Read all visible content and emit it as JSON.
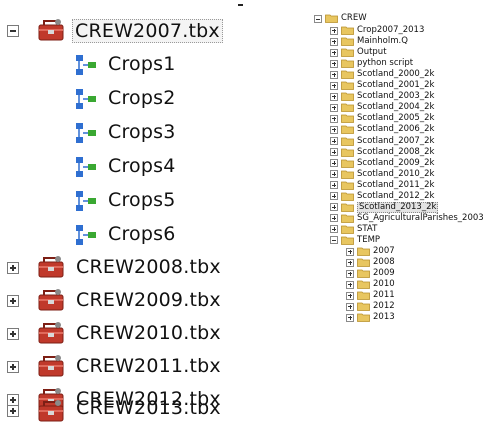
{
  "left_tree": {
    "root": {
      "label": "CREW2007.tbx",
      "expanded": true,
      "icon": "toolbox-icon"
    },
    "models": [
      {
        "label": "Crops1",
        "icon": "model-icon"
      },
      {
        "label": "Crops2",
        "icon": "model-icon"
      },
      {
        "label": "Crops3",
        "icon": "model-icon"
      },
      {
        "label": "Crops4",
        "icon": "model-icon"
      },
      {
        "label": "Crops5",
        "icon": "model-icon"
      },
      {
        "label": "Crops6",
        "icon": "model-icon"
      }
    ],
    "toolboxes": [
      {
        "label": "CREW2008.tbx",
        "expanded": false
      },
      {
        "label": "CREW2009.tbx",
        "expanded": false
      },
      {
        "label": "CREW2010.tbx",
        "expanded": false
      },
      {
        "label": "CREW2011.tbx",
        "expanded": false
      },
      {
        "label": "CREW2012.tbx",
        "expanded": false
      },
      {
        "label": "CREW2013.tbx",
        "expanded": false
      }
    ]
  },
  "right_tree": {
    "root": {
      "label": "CREW",
      "expanded": true
    },
    "folders": [
      {
        "label": "Crop2007_2013"
      },
      {
        "label": "Mainholm.Q"
      },
      {
        "label": "Output"
      },
      {
        "label": "python script"
      },
      {
        "label": "Scotland_2000_2k"
      },
      {
        "label": "Scotland_2001_2k"
      },
      {
        "label": "Scotland_2003_2k"
      },
      {
        "label": "Scotland_2004_2k"
      },
      {
        "label": "Scotland_2005_2k"
      },
      {
        "label": "Scotland_2006_2k"
      },
      {
        "label": "Scotland_2007_2k"
      },
      {
        "label": "Scotland_2008_2k"
      },
      {
        "label": "Scotland_2009_2k"
      },
      {
        "label": "Scotland_2010_2k"
      },
      {
        "label": "Scotland_2011_2k"
      },
      {
        "label": "Scotland_2012_2k"
      },
      {
        "label": "Scotland_2013_2k",
        "selected": true
      },
      {
        "label": "SG_AgriculturalParishes_2003"
      },
      {
        "label": "STAT"
      }
    ],
    "temp": {
      "label": "TEMP",
      "expanded": true,
      "children": [
        {
          "label": "2007"
        },
        {
          "label": "2008"
        },
        {
          "label": "2009"
        },
        {
          "label": "2010"
        },
        {
          "label": "2011"
        },
        {
          "label": "2012"
        },
        {
          "label": "2013"
        }
      ]
    }
  },
  "colors": {
    "folder": "#e8c660",
    "folder_edge": "#b8902a",
    "toolbox": "#c0392b",
    "model_blue": "#2f6fd1",
    "model_green": "#3aa832"
  }
}
